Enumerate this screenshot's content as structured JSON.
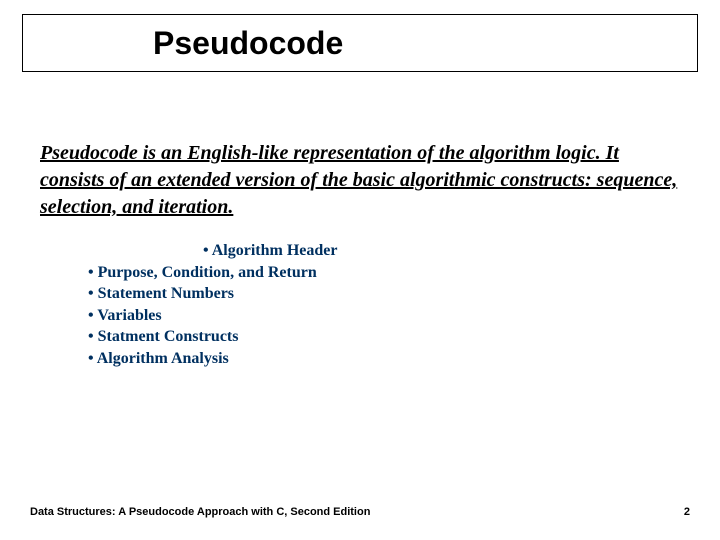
{
  "title": "Pseudocode",
  "intro": "Pseudocode is an English-like representation of the algorithm logic. It consists of an extended version of the basic algorithmic constructs: sequence, selection, and iteration.",
  "bullets": [
    "Algorithm Header",
    "Purpose, Condition, and Return",
    "Statement Numbers",
    "Variables",
    "Statment Constructs",
    "Algorithm Analysis"
  ],
  "footer_left": "Data Structures: A Pseudocode Approach with C, Second Edition",
  "footer_right": "2"
}
